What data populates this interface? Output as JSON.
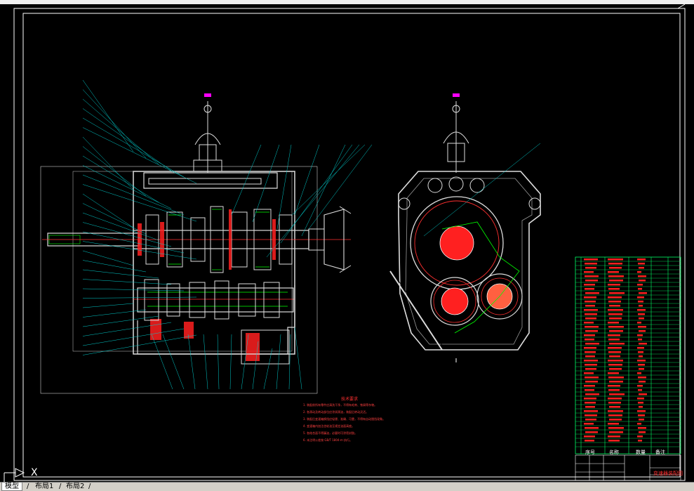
{
  "app": {
    "colors": {
      "background": "#000000",
      "frame": "#ffffff",
      "part_lines": "#ffffff",
      "leaders": "#00ffff",
      "section_fill": "#ff2020",
      "centerline": "#ff0000",
      "gear_teeth": "#00ff00",
      "bom_grid": "#00ff66",
      "bom_text": "#ff2020",
      "housing": "#c8c8c8"
    }
  },
  "tabs": {
    "model": "模型",
    "layout1": "布局1",
    "layout2": "布局2",
    "separator": "/"
  },
  "ucs": {
    "x_label": "X"
  },
  "drawing": {
    "notes_title": "技术要求",
    "notes": [
      "1. 装配前所有零件应清洗干净，不得有毛刺、铁屑等杂物。",
      "2. 各滑动及转动部位应涂润滑油，装配后转动灵活。",
      "3. 装配后变速箱换挡应轻便、准确、可靠，不得有自动脱挡现象。",
      "4. 变速箱内加注齿轮油至规定油面高度。",
      "5. 各结合面不得漏油，必要时可涂密封胶。",
      "6. 未注明公差按 GB/T 1804-m 执行。"
    ],
    "title_block_name": "变速器装配图",
    "bom_headers": [
      "序号",
      "名称",
      "数量",
      "备注"
    ]
  }
}
